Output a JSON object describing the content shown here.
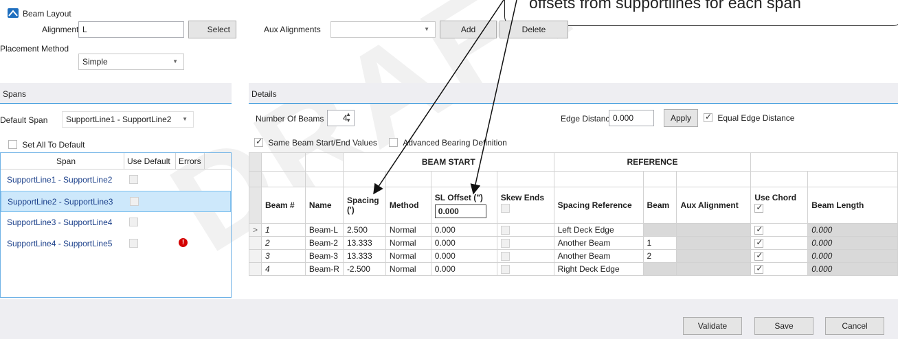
{
  "window": {
    "title": "Beam Layout"
  },
  "watermark": "DRAFT",
  "callout": {
    "text": "offsets from supportlines for each span"
  },
  "header": {
    "alignment_label": "Alignment",
    "alignment_value": "L",
    "select_label": "Select",
    "aux_label": "Aux Alignments",
    "aux_value": "",
    "add_label": "Add",
    "delete_label": "Delete",
    "placement_label": "Placement Method",
    "placement_value": "Simple"
  },
  "spans": {
    "section_title": "Spans",
    "default_span_label": "Default Span",
    "default_span_value": "SupportLine1 - SupportLine2",
    "set_all_label": "Set All To Default",
    "columns": [
      "Span",
      "Use Default",
      "Errors"
    ],
    "rows": [
      {
        "span": "SupportLine1 - SupportLine2",
        "use_default": false,
        "error": false
      },
      {
        "span": "SupportLine2 - SupportLine3",
        "use_default": false,
        "error": false,
        "selected": true
      },
      {
        "span": "SupportLine3 - SupportLine4",
        "use_default": false,
        "error": false
      },
      {
        "span": "SupportLine4 - SupportLine5",
        "use_default": false,
        "error": true
      }
    ]
  },
  "details": {
    "section_title": "Details",
    "num_beams_label": "Number Of Beams",
    "num_beams_value": "4",
    "edge_distance_label": "Edge Distance (')",
    "edge_distance_value": "0.000",
    "apply_label": "Apply",
    "equal_edge_label": "Equal Edge Distance",
    "equal_edge_checked": true,
    "same_beam_label": "Same Beam Start/End Values",
    "same_beam_checked": true,
    "advanced_bearing_label": "Advanced Bearing Definition",
    "advanced_bearing_checked": false,
    "group_beam_start": "BEAM START",
    "group_reference": "REFERENCE",
    "columns": {
      "beam_no": "Beam #",
      "name": "Name",
      "spacing": "Spacing (')",
      "method": "Method",
      "sl_offset": "SL Offset (\")",
      "sl_offset_value": "0.000",
      "skew_ends": "Skew Ends",
      "spacing_reference": "Spacing Reference",
      "beam": "Beam",
      "aux_alignment": "Aux Alignment",
      "use_chord": "Use Chord",
      "beam_length": "Beam Length"
    },
    "rows": [
      {
        "beam_no": "1",
        "name": "Beam-L",
        "spacing": "2.500",
        "method": "Normal",
        "sl_offset": "0.000",
        "spacing_reference": "Left Deck Edge",
        "beam": "",
        "use_chord": true,
        "beam_length": "0.000"
      },
      {
        "beam_no": "2",
        "name": "Beam-2",
        "spacing": "13.333",
        "method": "Normal",
        "sl_offset": "0.000",
        "spacing_reference": "Another Beam",
        "beam": "1",
        "use_chord": true,
        "beam_length": "0.000"
      },
      {
        "beam_no": "3",
        "name": "Beam-3",
        "spacing": "13.333",
        "method": "Normal",
        "sl_offset": "0.000",
        "spacing_reference": "Another Beam",
        "beam": "2",
        "use_chord": true,
        "beam_length": "0.000"
      },
      {
        "beam_no": "4",
        "name": "Beam-R",
        "spacing": "-2.500",
        "method": "Normal",
        "sl_offset": "0.000",
        "spacing_reference": "Right Deck Edge",
        "beam": "",
        "use_chord": true,
        "beam_length": "0.000"
      }
    ],
    "current_row_marker": ">"
  },
  "footer": {
    "validate_label": "Validate",
    "save_label": "Save",
    "cancel_label": "Cancel"
  },
  "colors": {
    "accent": "#1e8ad6",
    "selected_row": "#cde8fb",
    "error": "#d40000",
    "section_bg": "#eeeef2",
    "footer_bg": "#eeeef2"
  }
}
